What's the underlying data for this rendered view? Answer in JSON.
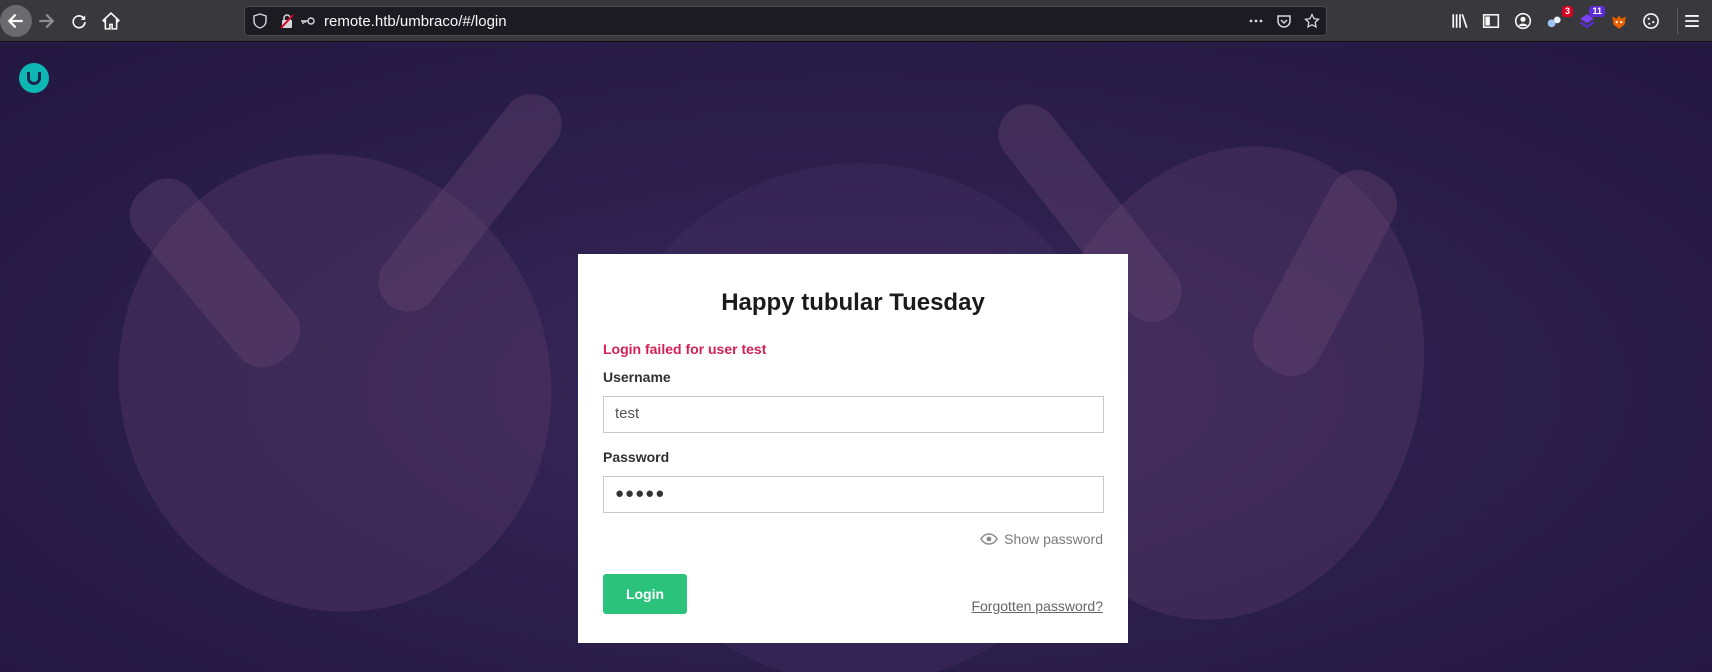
{
  "browser": {
    "url": "remote.htb/umbraco/#/login",
    "badges": {
      "extension_red": "3",
      "extension_purple": "11"
    }
  },
  "login": {
    "greeting": "Happy tubular Tuesday",
    "error_message": "Login failed for user test",
    "username_label": "Username",
    "username_value": "test",
    "password_label": "Password",
    "password_masked": "●●●●●",
    "show_password_label": "Show password",
    "login_button_label": "Login",
    "forgot_password_label": "Forgotten password?"
  },
  "colors": {
    "accent_green": "#2bc37c",
    "error_red": "#d42054",
    "logo_teal": "#0fb7b4",
    "background_purple": "#2c1f4c"
  }
}
